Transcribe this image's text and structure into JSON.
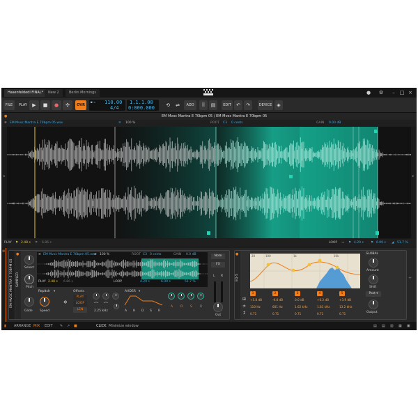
{
  "tabs": [
    {
      "label": "Hasenfeldedl FINAL*",
      "active": true
    },
    {
      "label": "New 2",
      "active": false
    },
    {
      "label": "Berlin Mornings",
      "active": false
    }
  ],
  "transport": {
    "file_label": "FILE",
    "play_label": "PLAY",
    "ovr_label": "OVR",
    "tempo": "110.00",
    "time_signature": "4/4",
    "position_bars": "1.1.1.00",
    "position_time": "0:000.000",
    "add_label": "ADD",
    "edit_label": "EDIT",
    "device_label": "DEVICE"
  },
  "editor": {
    "clip_name": "EM Mvoc Mantra E 70bpm 05.wav",
    "title": "EM Mvoc Mantra E 70bpm 05 / EM Mvoc Mantra E 70bpm 05",
    "zoom": "100 %",
    "root_label": "ROOT",
    "root_value": "C3",
    "cents": "0 cents",
    "gain_label": "GAIN",
    "gain_value": "0.00 dB",
    "play_label": "PLAY",
    "play_start": "2.48 s",
    "play_end": "6.86 s",
    "loop_label": "LOOP",
    "loop_start": "4.29 s",
    "loop_end": "6.09 s",
    "loop_pct": "51.7 %"
  },
  "sampler": {
    "device_vertical": "EM MVOC MANTRA E 70BPM 05",
    "name_vertical": "SAMPLER",
    "select_label": "Select",
    "pitch_label": "Pitch",
    "glide_label": "Glide",
    "clip_name": "EM Mvoc Mantra E 70bpm 05.wav",
    "zoom": "100 %",
    "root_label": "ROOT",
    "root_value": "C3",
    "cents": "0 cents",
    "gain_label": "GAIN",
    "gain_value": "0.0 dB",
    "play_label": "PLAY",
    "play_start": "2.48 s",
    "play_end": "6.86 s",
    "loop_label": "LOOP",
    "loop_start": "4.29 s",
    "loop_end": "6.09 s",
    "loop_pct": "51.7 %",
    "repitch_label": "Repitch",
    "speed_label": "Speed",
    "offsets_label": "Offsets",
    "mode_play": "PLAY",
    "mode_loop": "LOOP",
    "mode_len": "LEN",
    "freq_value": "2.25 kHz",
    "ahdsr_label": "AHDSR",
    "env_labels": [
      "A",
      "H",
      "D",
      "S",
      "R"
    ],
    "note_label": "Note",
    "fx_label": "FX",
    "out_label": "Out",
    "l_label": "L",
    "r_label": "R"
  },
  "eq": {
    "name_vertical": "EQ-5",
    "axis_labels": [
      "20",
      "100",
      "1k",
      "10k"
    ],
    "global_label": "GLOBAL",
    "amount_label": "Amount",
    "shift_label": "Shift",
    "output_label": "Output",
    "mode_value": "Post",
    "bands": [
      {
        "num": "1",
        "gain": "+5.8 dB",
        "freq": "110 Hz",
        "q": "0.71"
      },
      {
        "num": "2",
        "gain": "-9.8 dB",
        "freq": "601 Hz",
        "q": "0.71"
      },
      {
        "num": "3",
        "gain": "0.0 dB",
        "freq": "1.62 kHz",
        "q": "0.71"
      },
      {
        "num": "4",
        "gain": "+6.2 dB",
        "freq": "1.81 kHz",
        "q": "0.71"
      },
      {
        "num": "5",
        "gain": "+3.9 dB",
        "freq": "13.2 kHz",
        "q": "0.71"
      }
    ]
  },
  "bottombar": {
    "arrange": "ARRANGE",
    "mix": "MIX",
    "edit": "EDIT",
    "hint_key": "CLICK",
    "hint_text": "Minimize window"
  },
  "colors": {
    "accent": "#f07d1a",
    "lcd": "#47b6e8",
    "loop_region": "#1fb59a",
    "eq_graph": "#e9e1cf"
  }
}
